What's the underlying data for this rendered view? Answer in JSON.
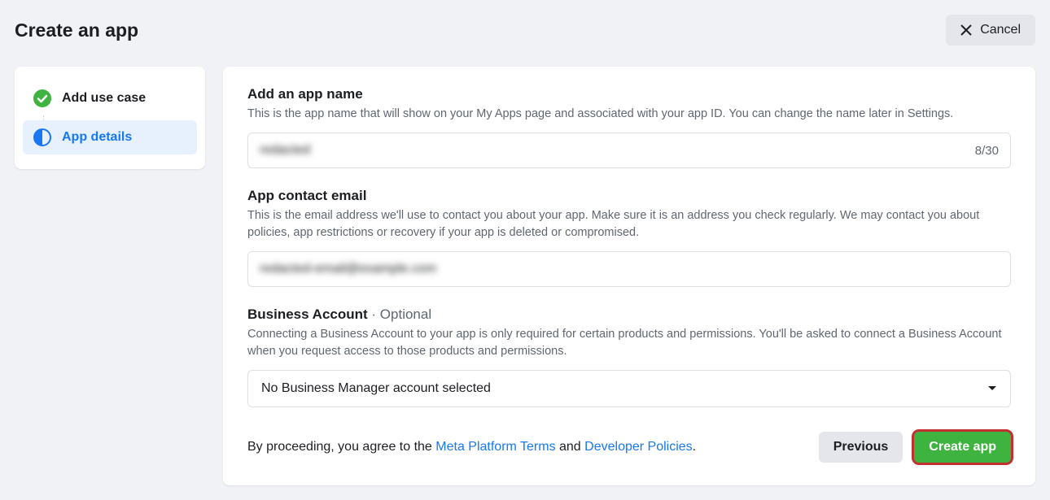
{
  "header": {
    "title": "Create an app",
    "cancel_label": "Cancel"
  },
  "sidebar": {
    "steps": [
      {
        "label": "Add use case",
        "state": "completed"
      },
      {
        "label": "App details",
        "state": "active"
      }
    ]
  },
  "form": {
    "app_name": {
      "title": "Add an app name",
      "desc": "This is the app name that will show on your My Apps page and associated with your app ID. You can change the name later in Settings.",
      "value": "redacted",
      "counter": "8/30"
    },
    "contact_email": {
      "title": "App contact email",
      "desc": "This is the email address we'll use to contact you about your app. Make sure it is an address you check regularly. We may contact you about policies, app restrictions or recovery if your app is deleted or compromised.",
      "value": "redacted-email@example.com"
    },
    "business_account": {
      "title": "Business Account",
      "optional": " · Optional",
      "desc": "Connecting a Business Account to your app is only required for certain products and permissions. You'll be asked to connect a Business Account when you request access to those products and permissions.",
      "selected": "No Business Manager account selected"
    }
  },
  "footer": {
    "disclaimer_prefix": "By proceeding, you agree to the ",
    "link1": "Meta Platform Terms",
    "middle": " and ",
    "link2": "Developer Policies",
    "suffix": ".",
    "previous_label": "Previous",
    "create_label": "Create app"
  }
}
